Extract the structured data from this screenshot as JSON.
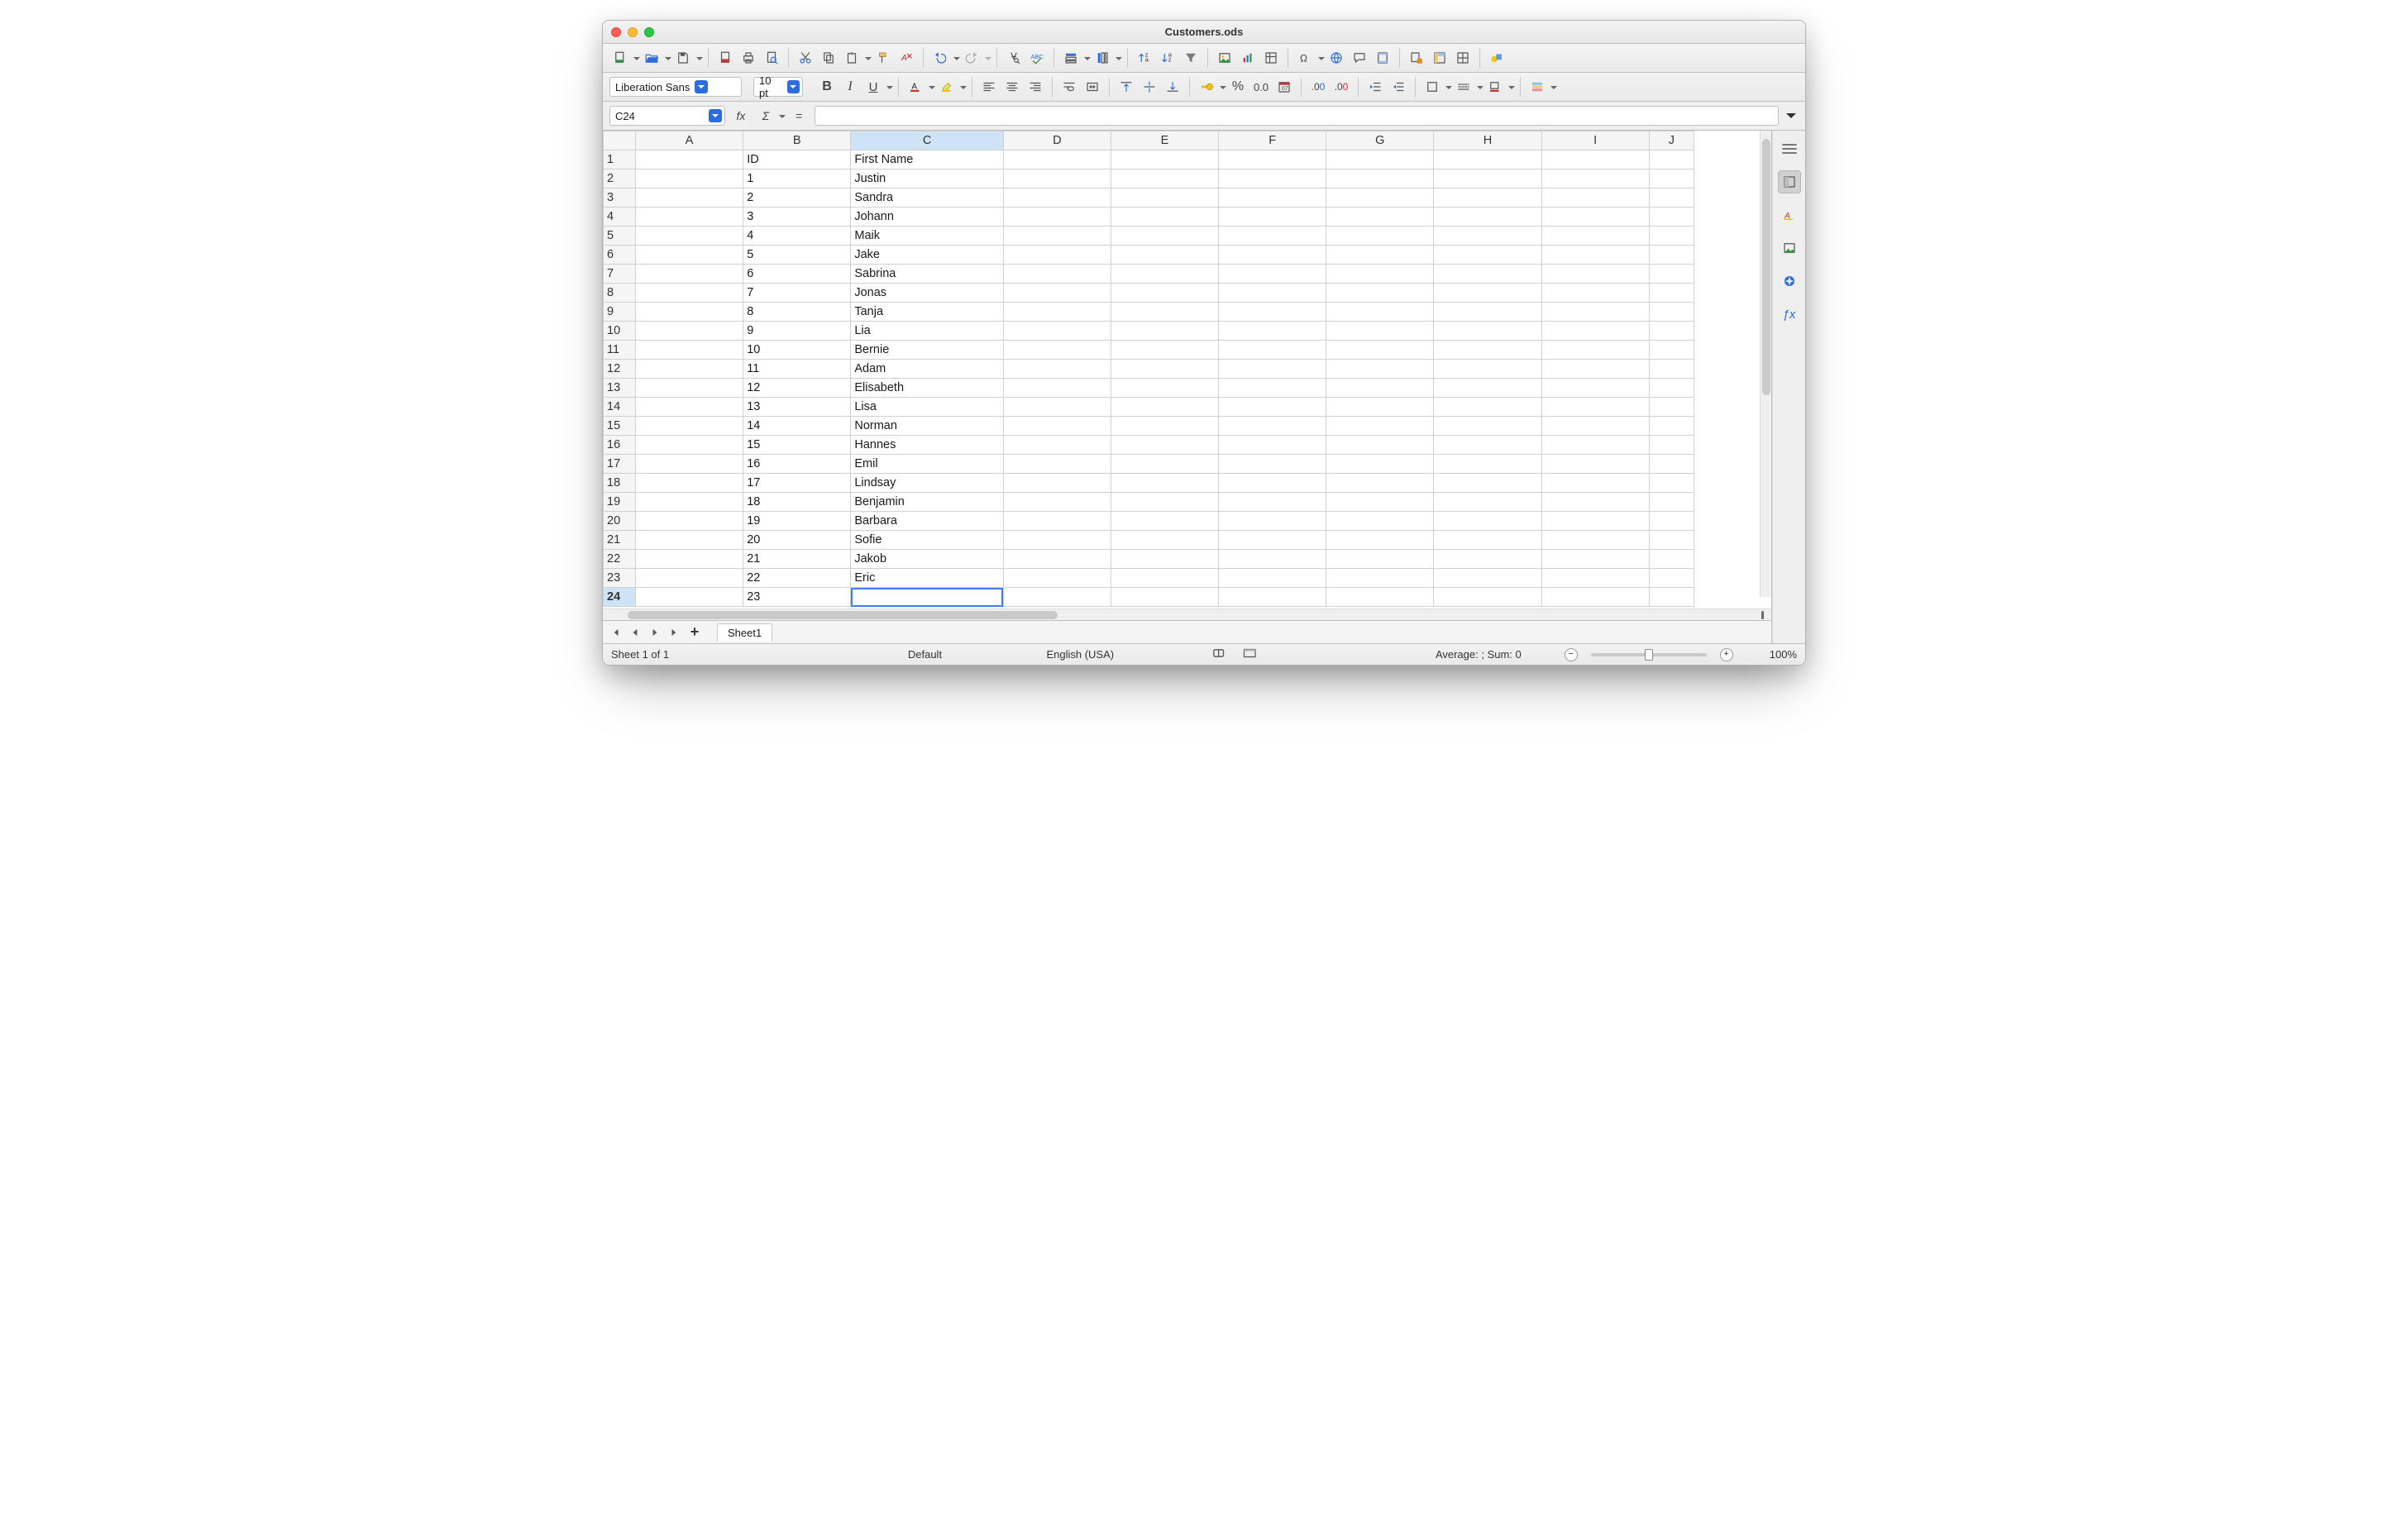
{
  "window": {
    "title": "Customers.ods"
  },
  "formatting": {
    "font_name": "Liberation Sans",
    "font_size": "10 pt"
  },
  "formula_bar": {
    "cell_ref": "C24",
    "formula": ""
  },
  "columns": [
    "A",
    "B",
    "C",
    "D",
    "E",
    "F",
    "G",
    "H",
    "I",
    "J"
  ],
  "selected_column": "C",
  "selected_row": 24,
  "active_cell": "C24",
  "rows": [
    {
      "n": 1,
      "B": "ID",
      "C": "First Name"
    },
    {
      "n": 2,
      "B": "1",
      "C": "Justin"
    },
    {
      "n": 3,
      "B": "2",
      "C": "Sandra"
    },
    {
      "n": 4,
      "B": "3",
      "C": "Johann"
    },
    {
      "n": 5,
      "B": "4",
      "C": "Maik"
    },
    {
      "n": 6,
      "B": "5",
      "C": "Jake"
    },
    {
      "n": 7,
      "B": "6",
      "C": "Sabrina"
    },
    {
      "n": 8,
      "B": "7",
      "C": "Jonas"
    },
    {
      "n": 9,
      "B": "8",
      "C": "Tanja"
    },
    {
      "n": 10,
      "B": "9",
      "C": "Lia"
    },
    {
      "n": 11,
      "B": "10",
      "C": "Bernie"
    },
    {
      "n": 12,
      "B": "11",
      "C": "Adam"
    },
    {
      "n": 13,
      "B": "12",
      "C": "Elisabeth"
    },
    {
      "n": 14,
      "B": "13",
      "C": "Lisa"
    },
    {
      "n": 15,
      "B": "14",
      "C": "Norman"
    },
    {
      "n": 16,
      "B": "15",
      "C": "Hannes"
    },
    {
      "n": 17,
      "B": "16",
      "C": "Emil"
    },
    {
      "n": 18,
      "B": "17",
      "C": "Lindsay"
    },
    {
      "n": 19,
      "B": "18",
      "C": "Benjamin"
    },
    {
      "n": 20,
      "B": "19",
      "C": "Barbara"
    },
    {
      "n": 21,
      "B": "20",
      "C": "Sofie"
    },
    {
      "n": 22,
      "B": "21",
      "C": "Jakob"
    },
    {
      "n": 23,
      "B": "22",
      "C": "Eric"
    },
    {
      "n": 24,
      "B": "23",
      "C": ""
    }
  ],
  "tabs": {
    "sheet1": "Sheet1"
  },
  "status": {
    "sheet_count": "Sheet 1 of 1",
    "style": "Default",
    "language": "English (USA)",
    "summary": "Average: ; Sum: 0",
    "zoom": "100%"
  },
  "fx_labels": {
    "fx": "fx",
    "sigma": "Σ",
    "eq": "="
  },
  "sidebar_fx": "ƒx"
}
